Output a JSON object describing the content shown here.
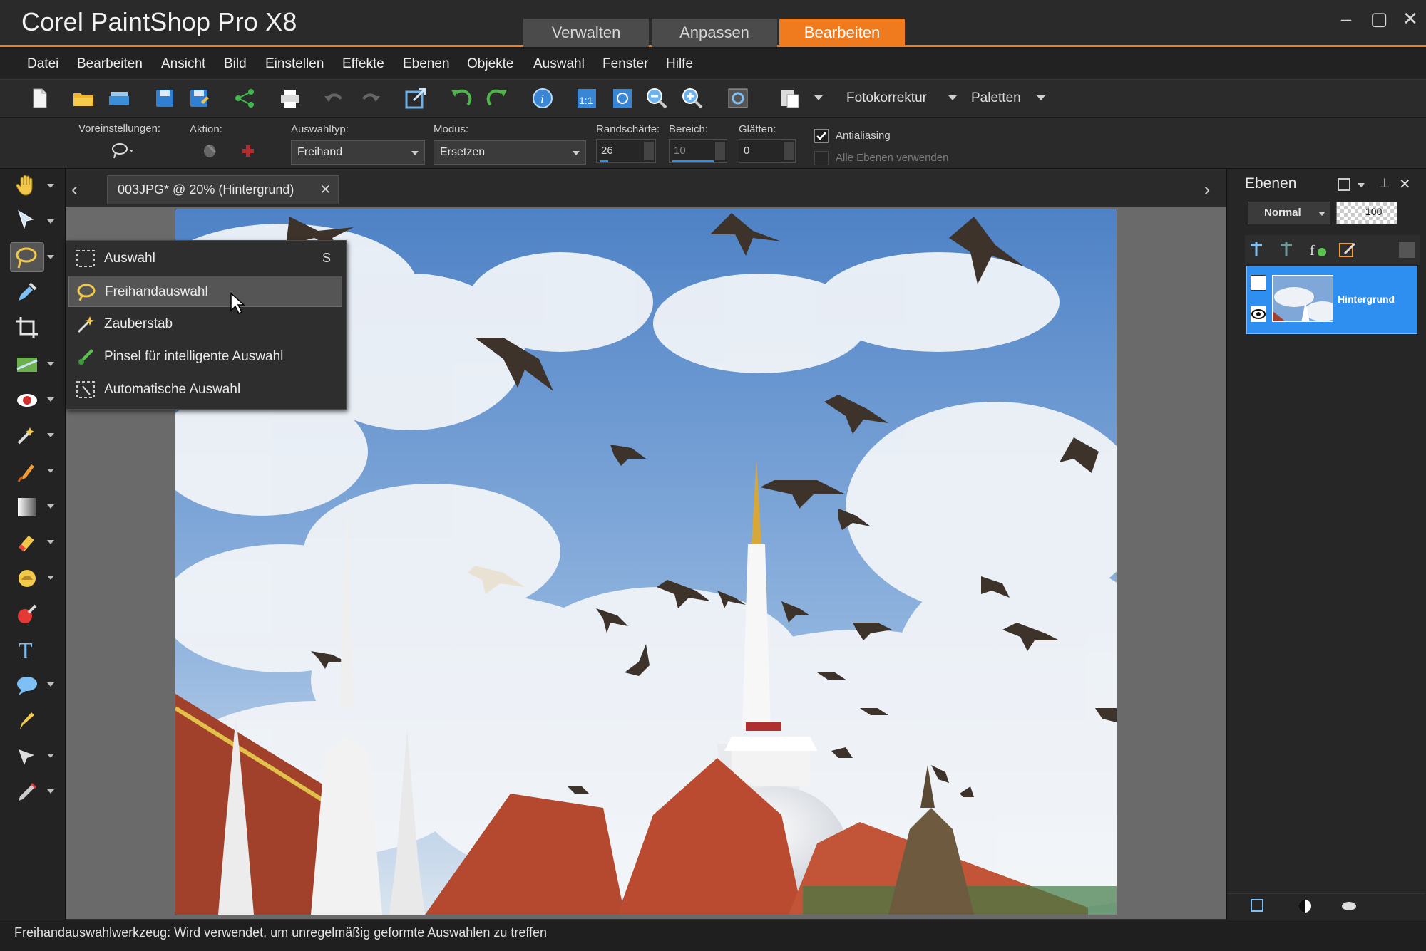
{
  "app": {
    "title": "Corel PaintShop Pro X8"
  },
  "workspace_tabs": [
    {
      "label": "Verwalten",
      "active": false
    },
    {
      "label": "Anpassen",
      "active": false
    },
    {
      "label": "Bearbeiten",
      "active": true
    }
  ],
  "window_controls": {
    "minimize": "–",
    "maximize": "▢",
    "close": "✕"
  },
  "menu": [
    "Datei",
    "Bearbeiten",
    "Ansicht",
    "Bild",
    "Einstellen",
    "Effekte",
    "Ebenen",
    "Objekte",
    "Auswahl",
    "Fenster",
    "Hilfe"
  ],
  "toolbar": {
    "icons": [
      "new-file-icon",
      "open-folder-icon",
      "scan-icon",
      "save-icon",
      "save-as-icon",
      "share-icon",
      "print-icon",
      "undo-icon",
      "redo-icon",
      "resize-icon",
      "rotate-left-icon",
      "rotate-right-icon",
      "info-icon",
      "actual-size-icon",
      "fit-window-icon",
      "zoom-out-icon",
      "zoom-in-icon",
      "overview-icon",
      "paste-icon"
    ],
    "fotokorrektur_label": "Fotokorrektur",
    "paletten_label": "Paletten"
  },
  "tool_options": {
    "presets_label": "Voreinstellungen:",
    "action_label": "Aktion:",
    "selection_type_label": "Auswahltyp:",
    "selection_type_value": "Freihand",
    "mode_label": "Modus:",
    "mode_value": "Ersetzen",
    "feather_label": "Randschärfe:",
    "feather_value": "26",
    "range_label": "Bereich:",
    "range_value": "10",
    "smooth_label": "Glätten:",
    "smooth_value": "0",
    "antialias_label": "Antialiasing",
    "antialias_checked": true,
    "all_layers_label": "Alle Ebenen verwenden",
    "all_layers_checked": false
  },
  "document": {
    "tab_label": "003JPG* @  20% (Hintergrund)",
    "close": "✕",
    "nav_prev": "‹",
    "nav_next": "›"
  },
  "flyout": {
    "items": [
      {
        "label": "Auswahl",
        "shortcut": "S",
        "icon": "rect-selection-icon",
        "highlighted": false
      },
      {
        "label": "Freihandauswahl",
        "shortcut": "",
        "icon": "lasso-icon",
        "highlighted": true
      },
      {
        "label": "Zauberstab",
        "shortcut": "",
        "icon": "magic-wand-icon",
        "highlighted": false
      },
      {
        "label": "Pinsel für intelligente Auswahl",
        "shortcut": "",
        "icon": "smart-selection-brush-icon",
        "highlighted": false
      },
      {
        "label": "Automatische Auswahl",
        "shortcut": "",
        "icon": "auto-selection-icon",
        "highlighted": false
      }
    ]
  },
  "layers_panel": {
    "title": "Ebenen",
    "blend_mode": "Normal",
    "opacity": "100",
    "layer_name": "Hintergrund"
  },
  "status": {
    "text": "Freihandauswahlwerkzeug: Wird verwendet, um unregelmäßig geformte Auswahlen zu treffen"
  },
  "colors": {
    "accent": "#f07a1e",
    "selection_blue": "#2f8ff0"
  }
}
